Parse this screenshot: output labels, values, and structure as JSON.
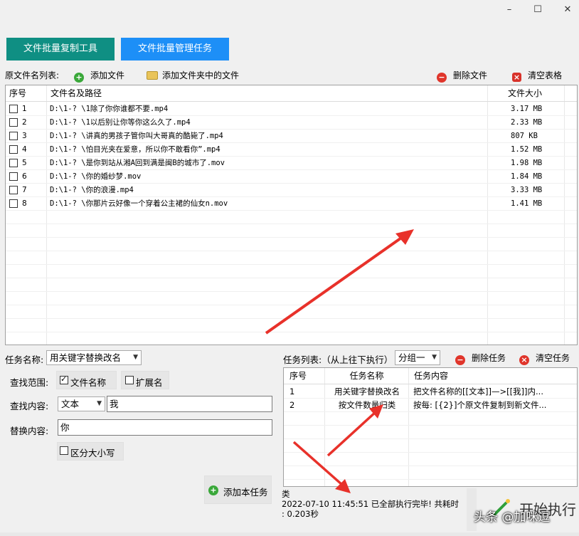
{
  "window": {
    "minimize": "–",
    "maximize": "☐",
    "close": "✕"
  },
  "tabs": [
    {
      "label": "文件批量复制工具",
      "color": "#0f8f83"
    },
    {
      "label": "文件批量管理任务",
      "color": "#1d8ff7"
    }
  ],
  "source_bar": {
    "label": "原文件名列表:",
    "add_file": "添加文件",
    "add_folder_files": "添加文件夹中的文件",
    "delete_file": "删除文件",
    "clear_table": "清空表格"
  },
  "file_table": {
    "columns": [
      "序号",
      "文件名及路径",
      "文件大小"
    ],
    "rows": [
      {
        "no": "1",
        "path": "D:\\1-? \\1除了你你谁都不要.mp4",
        "size": "3.17 MB"
      },
      {
        "no": "2",
        "path": "D:\\1-? \\1以后别让你等你这么久了.mp4",
        "size": "2.33 MB"
      },
      {
        "no": "3",
        "path": "D:\\1-? \\讲真的男孩子管你叫大哥真的酷毙了.mp4",
        "size": "807 KB"
      },
      {
        "no": "4",
        "path": "D:\\1-? \\怕目光夹在爱意，所以你不敢看你”.mp4",
        "size": "1.52 MB"
      },
      {
        "no": "5",
        "path": "D:\\1-? \\是你到站从湘A回到满是闽B的城市了.mov",
        "size": "1.98 MB"
      },
      {
        "no": "6",
        "path": "D:\\1-? \\你的婚纱梦.mov",
        "size": "1.84 MB"
      },
      {
        "no": "7",
        "path": "D:\\1-? \\你的浪漫.mp4",
        "size": "3.33 MB"
      },
      {
        "no": "8",
        "path": "D:\\1-? \\你那片云好像一个穿着公主裙的仙女n.mov",
        "size": "1.41 MB"
      }
    ]
  },
  "task_form": {
    "task_name_label": "任务名称:",
    "task_name_value": "用关键字替换改名",
    "scope_label": "查找范围:",
    "scope_filename": "文件名称",
    "scope_ext": "扩展名",
    "find_label": "查找内容:",
    "find_type": "文本",
    "find_value": "我",
    "replace_label": "替换内容:",
    "replace_value": "你",
    "case_label": "区分大小写",
    "add_task": "添加本任务"
  },
  "task_list": {
    "label": "任务列表:（从上往下执行）",
    "group_value": "分组一",
    "delete_task": "删除任务",
    "clear_task": "清空任务",
    "columns": [
      "序号",
      "任务名称",
      "任务内容"
    ],
    "rows": [
      {
        "no": "1",
        "name": "用关键字替换改名",
        "content": "把文件名称的[[文本]]—>[[我]]内..."
      },
      {
        "no": "2",
        "name": "按文件数量归类",
        "content": "按每: [{2}]个原文件复制到新文件..."
      }
    ]
  },
  "log": {
    "line1": "类",
    "line2": "2022-07-10 11:45:51 已全部执行完毕! 共耗时",
    "line3": ": 0.203秒"
  },
  "run_button": "开始执行",
  "watermark": "头条 @加咪逗",
  "colors": {
    "arrow": "#e8312a"
  }
}
